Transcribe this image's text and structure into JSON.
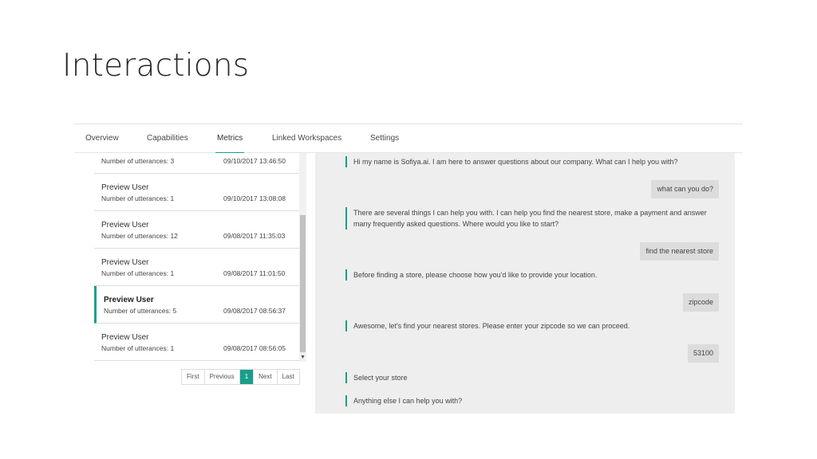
{
  "slide": {
    "title": "Interactions"
  },
  "tabs": [
    "Overview",
    "Capabilities",
    "Metrics",
    "Linked Workspaces",
    "Settings"
  ],
  "conversations": [
    {
      "name": "",
      "count": "Number of utterances: 3",
      "ts": "09/10/2017 13:46:50"
    },
    {
      "name": "Preview User",
      "count": "Number of utterances: 1",
      "ts": "09/10/2017 13:08:08"
    },
    {
      "name": "Preview User",
      "count": "Number of utterances: 12",
      "ts": "09/08/2017 11:35:03"
    },
    {
      "name": "Preview User",
      "count": "Number of utterances: 1",
      "ts": "09/08/2017 11:01:50"
    },
    {
      "name": "Preview User",
      "count": "Number of utterances: 5",
      "ts": "09/08/2017 08:56:37"
    },
    {
      "name": "Preview User",
      "count": "Number of utterances: 1",
      "ts": "09/08/2017 08:56:05"
    }
  ],
  "pager": {
    "first": "First",
    "previous": "Previous",
    "current": "1",
    "next": "Next",
    "last": "Last"
  },
  "chat": {
    "m1": "Hi my name is Sofiya.ai. I am here to answer questions about our company. What can I help you with?",
    "u1": "what can you do?",
    "m2a": "There are several things I can help you with. I can help you find the nearest store, make a payment and answer",
    "m2b": "many frequently asked questions. Where would you like to start?",
    "u2": "find the nearest store",
    "m3": "Before finding a store, please choose how you'd like to provide your location.",
    "u3": "zipcode",
    "m4": "Awesome, let's find your nearest stores. Please enter your zipcode so we can proceed.",
    "u4": "53100",
    "m5": "Select your store",
    "m6": "Anything else I can help you with?"
  },
  "colors": {
    "accent": "#1a9e8a",
    "chat_bg": "#eeeeee",
    "user_bubble": "#dcdcdc"
  }
}
